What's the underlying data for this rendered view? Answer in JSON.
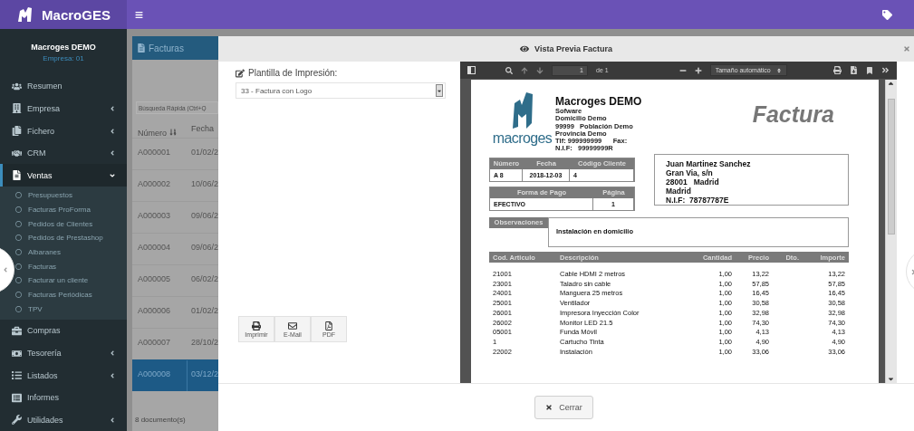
{
  "topbar": {
    "brand": "MacroGES"
  },
  "sidebar": {
    "user": "Macroges DEMO",
    "company": "Empresa: 01",
    "items": [
      {
        "label": "Resumen",
        "submenu": false,
        "expanded": false
      },
      {
        "label": "Empresa",
        "submenu": true,
        "expanded": false
      },
      {
        "label": "Fichero",
        "submenu": true,
        "expanded": false
      },
      {
        "label": "CRM",
        "submenu": true,
        "expanded": false
      },
      {
        "label": "Ventas",
        "submenu": true,
        "expanded": true,
        "children": [
          {
            "label": "Presupuestos"
          },
          {
            "label": "Facturas ProForma"
          },
          {
            "label": "Pedidos de Clientes"
          },
          {
            "label": "Pedidos de Prestashop"
          },
          {
            "label": "Albaranes"
          },
          {
            "label": "Facturas"
          },
          {
            "label": "Facturar un cliente"
          },
          {
            "label": "Facturas Periódicas"
          },
          {
            "label": "TPV"
          }
        ]
      },
      {
        "label": "Compras",
        "submenu": false,
        "expanded": false
      },
      {
        "label": "Tesorería",
        "submenu": true,
        "expanded": false
      },
      {
        "label": "Listados",
        "submenu": true,
        "expanded": false
      },
      {
        "label": "Informes",
        "submenu": false,
        "expanded": false
      },
      {
        "label": "Utilidades",
        "submenu": true,
        "expanded": false
      }
    ]
  },
  "list_panel": {
    "title": "Facturas",
    "search": {
      "placeholder": "Búsqueda Rápida (Ctrl+Q"
    },
    "columns": [
      "Número",
      "Fecha"
    ],
    "rows": [
      {
        "number": "A000001",
        "date": "01/02/2",
        "selected": false
      },
      {
        "number": "A000002",
        "date": "10/06/2",
        "selected": false
      },
      {
        "number": "A000003",
        "date": "09/06/2",
        "selected": false
      },
      {
        "number": "A000004",
        "date": "09/06/2",
        "selected": false
      },
      {
        "number": "A000005",
        "date": "06/02/2",
        "selected": false
      },
      {
        "number": "A000006",
        "date": "01/02/2",
        "selected": false
      },
      {
        "number": "A000007",
        "date": "28/10/2",
        "selected": false
      },
      {
        "number": "A000008",
        "date": "03/12/2",
        "selected": true
      }
    ],
    "footer": "8 documento(s)"
  },
  "modal": {
    "title": "Vista Previa Factura",
    "template_label": "Plantilla de Impresión:",
    "template_value": "33 - Factura con Logo",
    "actions": [
      {
        "label": "Imprimir"
      },
      {
        "label": "E-Mail"
      },
      {
        "label": "PDF"
      }
    ],
    "viewer": {
      "page": "1",
      "page_count": "de 1",
      "zoom": "Tamaño automático"
    },
    "close_button": "Cerrar"
  },
  "invoice": {
    "logo_text": "macroges",
    "company": {
      "name": "Macroges DEMO",
      "lines": [
        "Sofware",
        "Domicilio Demo",
        "99999   Población Demo",
        "Provincia Demo",
        "Tlf: 999999999      Fax:",
        "N.I.F:   99999999R"
      ]
    },
    "title": "Factura",
    "document_table": {
      "columns": [
        "Número",
        "Fecha",
        "Código Cliente"
      ],
      "values": [
        "A 8",
        "2018-12-03",
        "4"
      ]
    },
    "payment_table": {
      "columns": [
        "Forma de Pago",
        "Página"
      ],
      "values": [
        "EFECTIVO",
        "1"
      ]
    },
    "customer": [
      "Juan Martinez Sanchez",
      "Gran Via, s/n",
      "28001   Madrid",
      "Madrid",
      "N.I.F:  78787787E"
    ],
    "observations": {
      "label": "Observaciones",
      "text": "Instalación en domicilio"
    },
    "items": {
      "columns": [
        "Cod. Articulo",
        "Descripción",
        "Cantidad",
        "Precio",
        "Dto.",
        "Importe"
      ],
      "rows": [
        {
          "code": "21001",
          "description": "Cable HDMI 2 metros",
          "quantity": "1,00",
          "price": "13,22",
          "amount": "13,22"
        },
        {
          "code": "23001",
          "description": "Taladro sin cable",
          "quantity": "1,00",
          "price": "57,85",
          "amount": "57,85"
        },
        {
          "code": "24001",
          "description": "Manguera 25 metros",
          "quantity": "1,00",
          "price": "16,45",
          "amount": "16,45"
        },
        {
          "code": "25001",
          "description": "Ventilador",
          "quantity": "1,00",
          "price": "30,58",
          "amount": "30,58"
        },
        {
          "code": "26001",
          "description": "Impresora Inyección Color",
          "quantity": "1,00",
          "price": "32,98",
          "amount": "32,98"
        },
        {
          "code": "26002",
          "description": "Monitor LED 21.5",
          "quantity": "1,00",
          "price": "74,30",
          "amount": "74,30"
        },
        {
          "code": "05001",
          "description": "Funda Móvil",
          "quantity": "1,00",
          "price": "4,13",
          "amount": "4,13"
        },
        {
          "code": "1",
          "description": "Cartucho Tinta",
          "quantity": "1,00",
          "price": "4,90",
          "amount": "4,90"
        },
        {
          "code": "22002",
          "description": "Instalación",
          "quantity": "1,00",
          "price": "33,06",
          "amount": "33,06"
        }
      ]
    }
  }
}
